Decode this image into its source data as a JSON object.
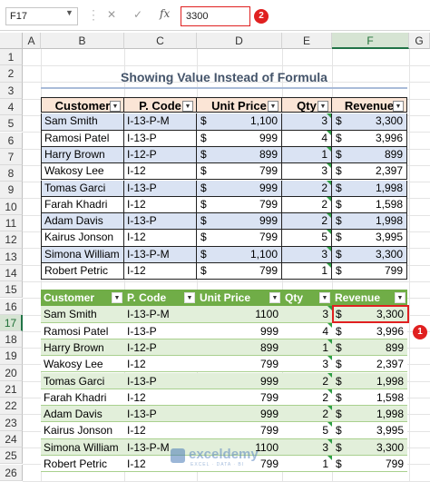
{
  "formula_bar": {
    "name_box": "F17",
    "cancel_icon": "✕",
    "enter_icon": "✓",
    "function_icon": "fx",
    "formula": "3300",
    "badge_formula": "2",
    "badge_cell": "1"
  },
  "columns": [
    "A",
    "B",
    "C",
    "D",
    "E",
    "F",
    "G"
  ],
  "rows": [
    "1",
    "2",
    "3",
    "4",
    "5",
    "6",
    "7",
    "8",
    "9",
    "10",
    "11",
    "12",
    "13",
    "14",
    "15",
    "16",
    "17",
    "18",
    "19",
    "20",
    "21",
    "22",
    "23",
    "24",
    "25",
    "26"
  ],
  "title": "Showing Value Instead of Formula",
  "table1": {
    "headers": [
      "Customer",
      "P. Code",
      "Unit Price",
      "Qty",
      "Revenue"
    ],
    "currency": "$",
    "rows": [
      {
        "customer": "Sam Smith",
        "code": "I-13-P-M",
        "price": "1,100",
        "qty": "3",
        "revenue": "3,300"
      },
      {
        "customer": "Ramosi Patel",
        "code": "I-13-P",
        "price": "999",
        "qty": "4",
        "revenue": "3,996"
      },
      {
        "customer": "Harry Brown",
        "code": "I-12-P",
        "price": "899",
        "qty": "1",
        "revenue": "899"
      },
      {
        "customer": "Wakosy Lee",
        "code": "I-12",
        "price": "799",
        "qty": "3",
        "revenue": "2,397"
      },
      {
        "customer": "Tomas Garci",
        "code": "I-13-P",
        "price": "999",
        "qty": "2",
        "revenue": "1,998"
      },
      {
        "customer": "Farah Khadri",
        "code": "I-12",
        "price": "799",
        "qty": "2",
        "revenue": "1,598"
      },
      {
        "customer": "Adam Davis",
        "code": "I-13-P",
        "price": "999",
        "qty": "2",
        "revenue": "1,998"
      },
      {
        "customer": "Kairus Jonson",
        "code": "I-12",
        "price": "799",
        "qty": "5",
        "revenue": "3,995"
      },
      {
        "customer": "Simona William",
        "code": "I-13-P-M",
        "price": "1,100",
        "qty": "3",
        "revenue": "3,300"
      },
      {
        "customer": "Robert Petric",
        "code": "I-12",
        "price": "799",
        "qty": "1",
        "revenue": "799"
      }
    ]
  },
  "table2": {
    "headers": [
      "Customer",
      "P. Code",
      "Unit Price",
      "Qty",
      "Revenue"
    ],
    "currency": "$",
    "rows": [
      {
        "customer": "Sam Smith",
        "code": "I-13-P-M",
        "price": "1100",
        "qty": "3",
        "revenue": "3,300"
      },
      {
        "customer": "Ramosi Patel",
        "code": "I-13-P",
        "price": "999",
        "qty": "4",
        "revenue": "3,996"
      },
      {
        "customer": "Harry Brown",
        "code": "I-12-P",
        "price": "899",
        "qty": "1",
        "revenue": "899"
      },
      {
        "customer": "Wakosy Lee",
        "code": "I-12",
        "price": "799",
        "qty": "3",
        "revenue": "2,397"
      },
      {
        "customer": "Tomas Garci",
        "code": "I-13-P",
        "price": "999",
        "qty": "2",
        "revenue": "1,998"
      },
      {
        "customer": "Farah Khadri",
        "code": "I-12",
        "price": "799",
        "qty": "2",
        "revenue": "1,598"
      },
      {
        "customer": "Adam Davis",
        "code": "I-13-P",
        "price": "999",
        "qty": "2",
        "revenue": "1,998"
      },
      {
        "customer": "Kairus Jonson",
        "code": "I-12",
        "price": "799",
        "qty": "5",
        "revenue": "3,995"
      },
      {
        "customer": "Simona William",
        "code": "I-13-P-M",
        "price": "1100",
        "qty": "3",
        "revenue": "3,300"
      },
      {
        "customer": "Robert Petric",
        "code": "I-12",
        "price": "799",
        "qty": "1",
        "revenue": "799"
      }
    ]
  },
  "watermark": {
    "name": "exceldemy",
    "tagline": "EXCEL · DATA · BI"
  },
  "colors": {
    "accent": "#217346",
    "table1_header": "#fbe5d6",
    "table1_band": "#dae3f3",
    "table2_header": "#70ad47",
    "table2_band": "#e2efda",
    "highlight": "#e02020"
  }
}
